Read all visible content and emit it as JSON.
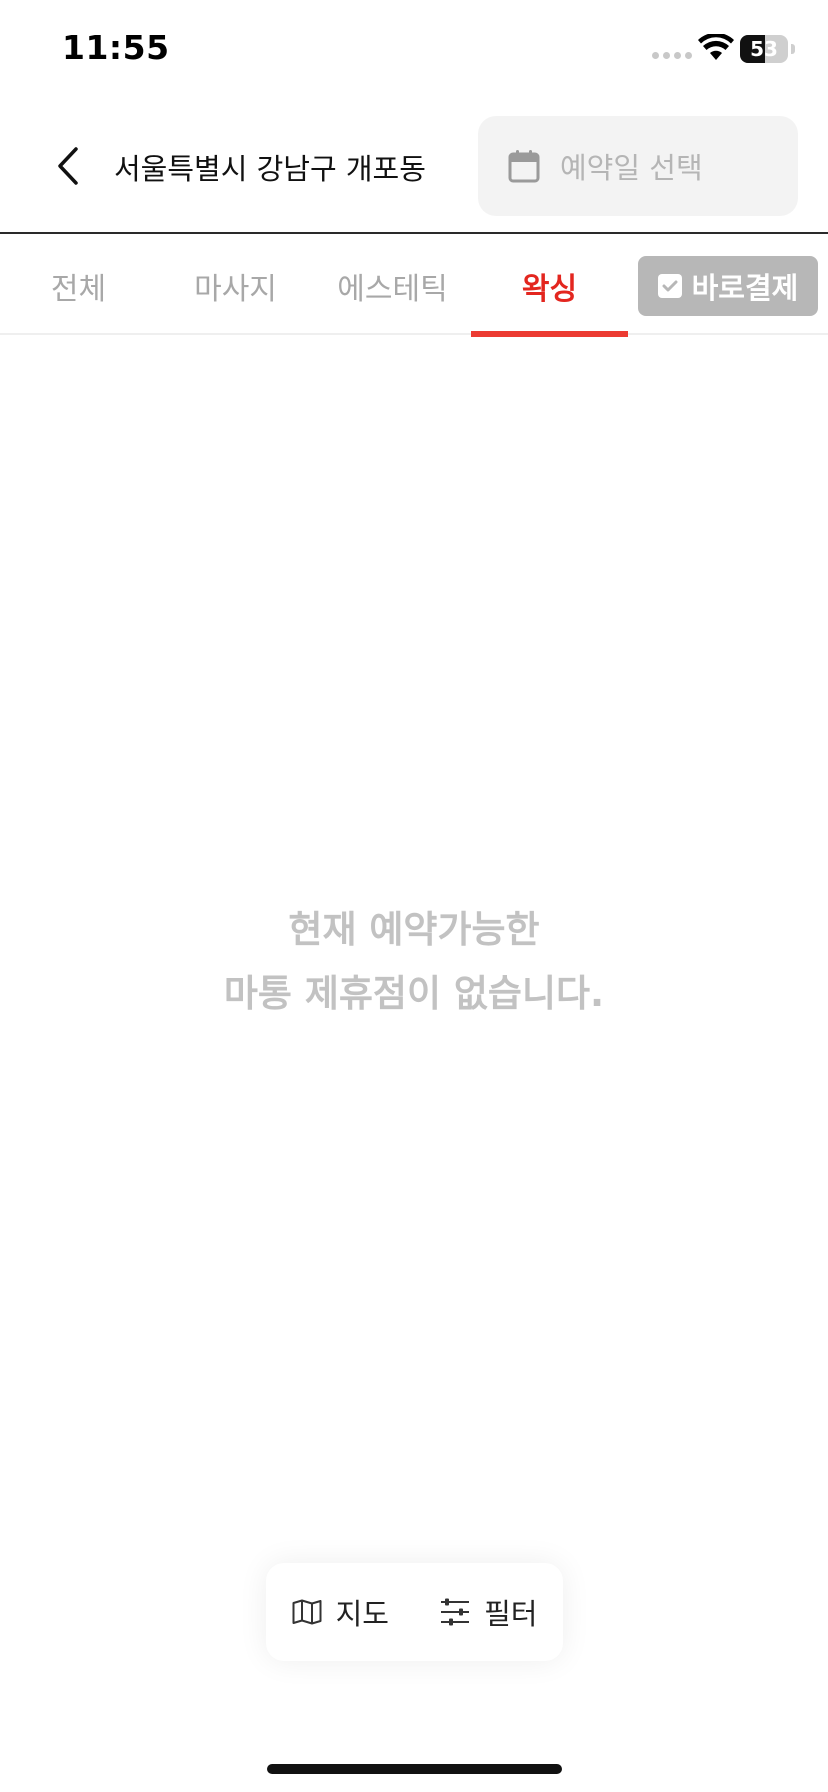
{
  "status_bar": {
    "time": "11:55",
    "battery_level": "53",
    "battery_fill_fraction": 0.53,
    "wifi_icon": "wifi-icon",
    "signal_icon": "cellular-signal-icon"
  },
  "header": {
    "back_icon": "chevron-left-icon",
    "location": "서울특별시 강남구 개포동",
    "date_picker": {
      "icon": "calendar-icon",
      "placeholder": "예약일 선택"
    }
  },
  "tabs": [
    {
      "label": "전체",
      "active": false
    },
    {
      "label": "마사지",
      "active": false
    },
    {
      "label": "에스테틱",
      "active": false
    },
    {
      "label": "왁싱",
      "active": true
    }
  ],
  "direct_pay": {
    "label": "바로결제",
    "checked": true,
    "icon": "checkbox-icon"
  },
  "empty_state": {
    "line1": "현재 예약가능한",
    "line2": "마통 제휴점이 없습니다."
  },
  "bottom_bar": {
    "map_label": "지도",
    "map_icon": "map-icon",
    "filter_label": "필터",
    "filter_icon": "filter-sliders-icon"
  },
  "colors": {
    "accent": "#e3261f",
    "inactive_text": "#a8a8a8",
    "direct_pay_bg": "#b7b7b7",
    "empty_text": "#c2c2c2"
  }
}
